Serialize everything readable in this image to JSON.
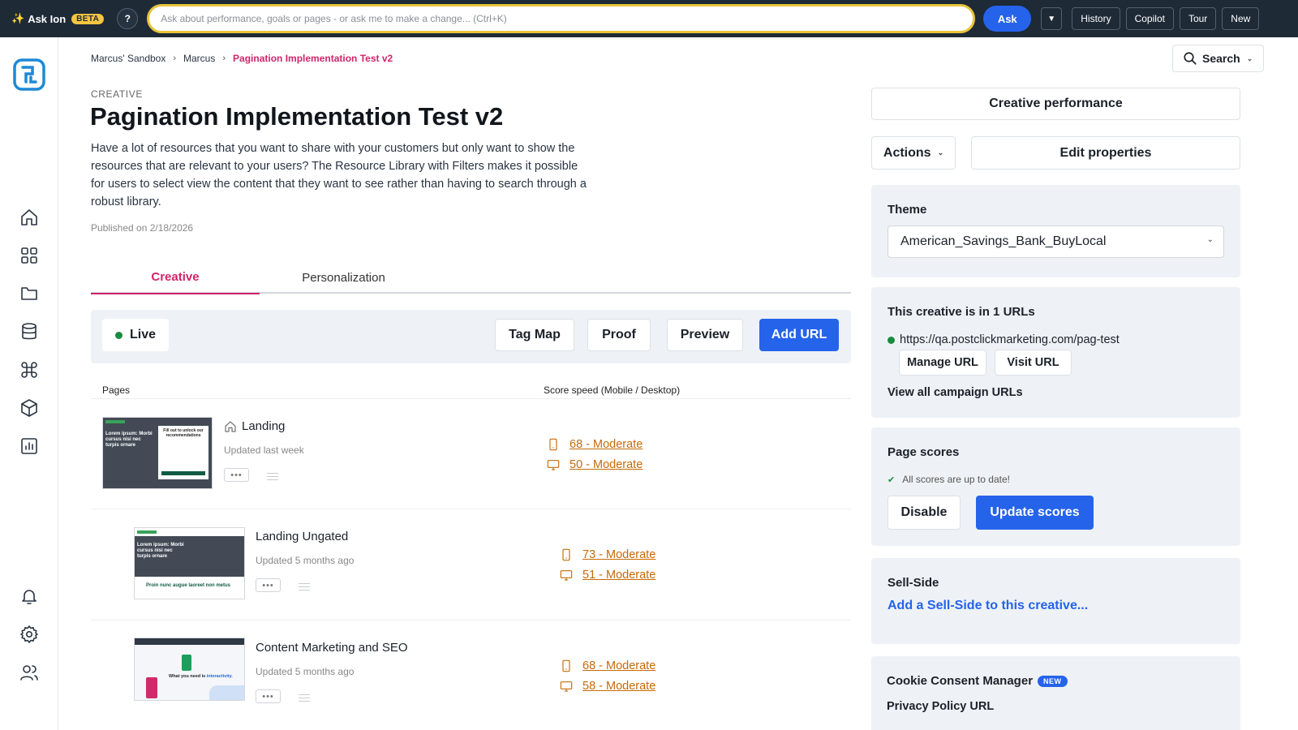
{
  "topbar": {
    "brand": "Ask Ion",
    "beta": "BETA",
    "help": "?",
    "ask_placeholder": "Ask about performance, goals or pages - or ask me to make a change... (Ctrl+K)",
    "ask_button": "Ask",
    "dropdown": "▼",
    "links": [
      "History",
      "Copilot",
      "Tour",
      "New"
    ]
  },
  "breadcrumb": {
    "items": [
      "Marcus' Sandbox",
      "Marcus"
    ],
    "current": "Pagination Implementation Test v2"
  },
  "search": {
    "label": "Search"
  },
  "creative": {
    "kicker": "CREATIVE",
    "title": "Pagination Implementation Test v2",
    "description": "Have a lot of resources that you want to share with your customers but only want to show the resources that are relevant to your users? The Resource Library with Filters makes it possible for users to select view the content that they want to see rather than having to search through a robust library.",
    "published": "Published on 2/18/2026"
  },
  "tabs": [
    "Creative",
    "Personalization"
  ],
  "toolbar": {
    "status": "Live",
    "buttons": [
      "Tag Map",
      "Proof",
      "Preview",
      "Add URL"
    ]
  },
  "table": {
    "col_pages": "Pages",
    "col_score": "Score speed (Mobile / Desktop)",
    "rows": [
      {
        "name": "Landing",
        "updated": "Updated last week",
        "mobile": "68 - Moderate",
        "desktop": "50 - Moderate"
      },
      {
        "name": "Landing Ungated",
        "updated": "Updated 5 months ago",
        "mobile": "73 - Moderate",
        "desktop": "51 - Moderate"
      },
      {
        "name": "Content Marketing and SEO",
        "updated": "Updated 5 months ago",
        "mobile": "68 - Moderate",
        "desktop": "58 - Moderate"
      }
    ],
    "menu_glyph": "•••"
  },
  "thumbs": {
    "landing_heading": "Lorem ipsum: Morbi cursus nisi nec turpis ornare",
    "landing_form": "Fill out to unlock our recommendations",
    "ungated_caption": "Proin nunc augue laoreet non metus",
    "seo_caption_a": "What you need is",
    "seo_caption_b": "interactivity."
  },
  "right": {
    "performance": "Creative performance",
    "actions": "Actions",
    "edit": "Edit properties",
    "theme_title": "Theme",
    "theme_value": "American_Savings_Bank_BuyLocal",
    "urls_title": "This creative is in 1 URLs",
    "url": "https://qa.postclickmarketing.com/pag-test",
    "manage_url": "Manage URL",
    "visit_url": "Visit URL",
    "view_all": "View all campaign URLs",
    "scores_title": "Page scores",
    "scores_note": "All scores are up to date!",
    "disable": "Disable",
    "update_scores": "Update scores",
    "sellside_title": "Sell-Side",
    "sellside_link": "Add a Sell-Side to this creative...",
    "cookie_title": "Cookie Consent Manager",
    "cookie_badge": "NEW",
    "privacy": "Privacy Policy URL"
  },
  "colors": {
    "accent_pink": "#d1246a",
    "primary_blue": "#2563eb",
    "score_orange": "#c56a08",
    "live_green": "#1a8a3f",
    "topbar_bg": "#1f2a37",
    "ask_outline": "#e8c43b"
  },
  "icons": {
    "rail": [
      "logo-icon",
      "home-icon",
      "grid-icon",
      "folder-icon",
      "database-icon",
      "command-icon",
      "cube-icon",
      "chart-icon",
      "bell-icon",
      "gear-icon",
      "users-icon"
    ],
    "scores": [
      "mobile-icon",
      "desktop-icon"
    ]
  }
}
